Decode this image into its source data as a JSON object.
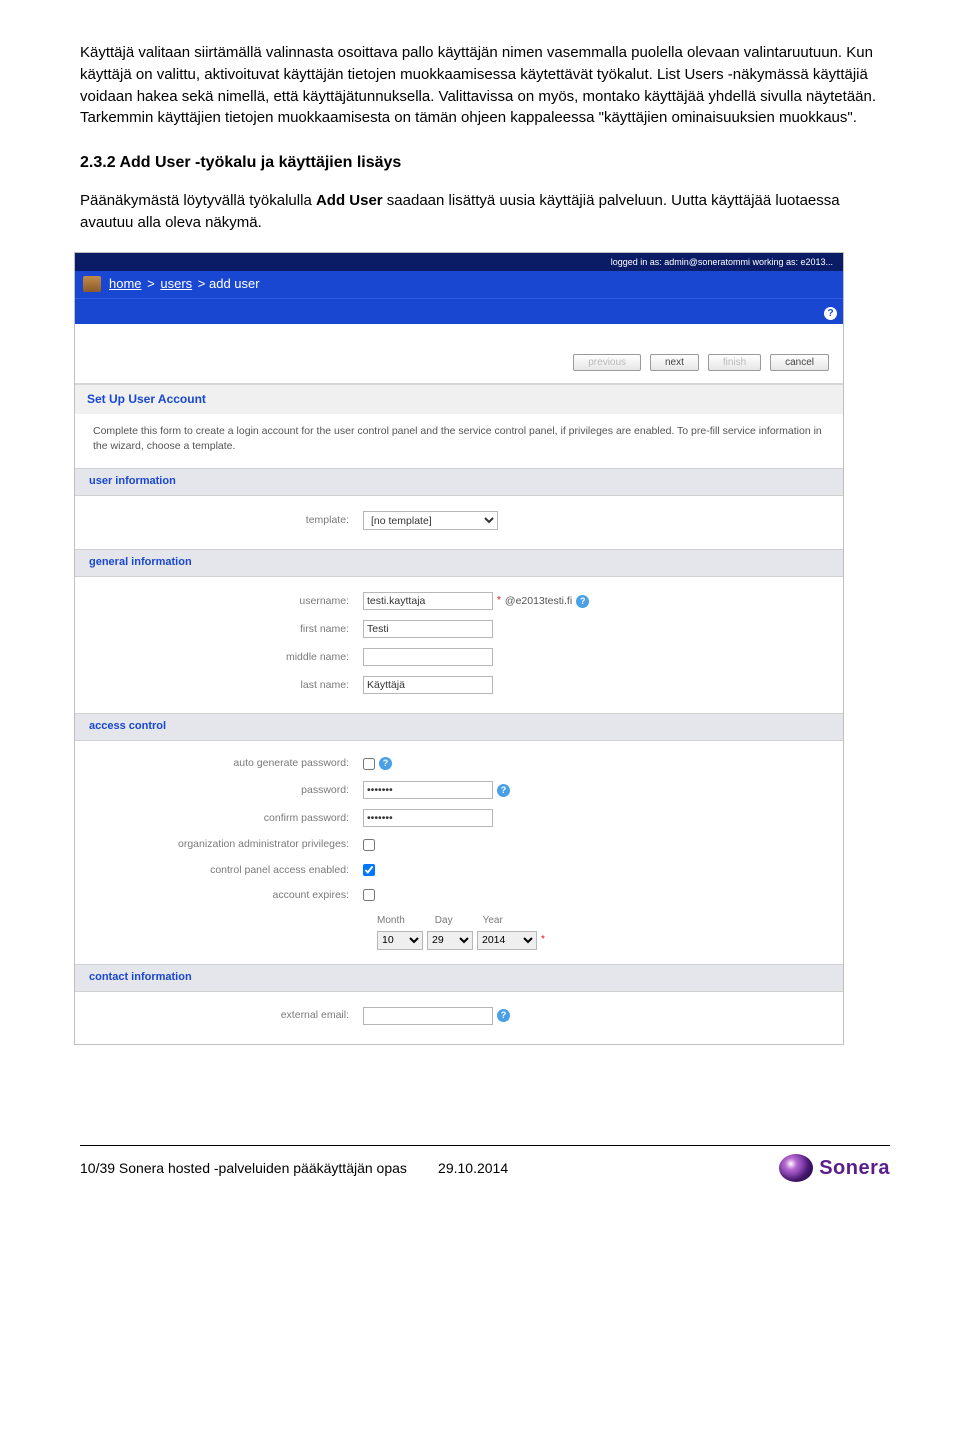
{
  "doc": {
    "p1": "Käyttäjä valitaan siirtämällä valinnasta osoittava pallo käyttäjän nimen vasemmalla puolella olevaan valintaruutuun. Kun käyttäjä on valittu, aktivoituvat käyttäjän tietojen muokkaamisessa käytettävät työkalut. List Users -näkymässä käyttäjiä voidaan hakea sekä nimellä, että käyttäjätunnuksella. Valittavissa on myös, montako käyttäjää yhdellä sivulla näytetään. Tarkemmin käyttäjien tietojen muokkaamisesta on tämän ohjeen kappaleessa \"käyttäjien ominaisuuksien muokkaus\".",
    "h3": "2.3.2 Add User -työkalu ja käyttäjien lisäys",
    "p2a": "Päänäkymästä löytyvällä työkalulla ",
    "p2b": "Add User",
    "p2c": " saadaan lisättyä uusia käyttäjiä palveluun. Uutta käyttäjää luotaessa avautuu alla oleva näkymä."
  },
  "topbar": "logged in as: admin@soneratommi   working as: e2013...",
  "crumbs": {
    "home": "home",
    "users": "users",
    "adduser": "add user"
  },
  "wizard": {
    "previous": "previous",
    "next": "next",
    "finish": "finish",
    "cancel": "cancel"
  },
  "setup": {
    "title": "Set Up User Account",
    "desc": "Complete this form to create a login account for the user control panel and the service control panel, if privileges are enabled. To pre-fill service information in the wizard, choose a template."
  },
  "sections": {
    "userinfo": "user information",
    "general": "general information",
    "access": "access control",
    "contact": "contact information"
  },
  "labels": {
    "template": "template:",
    "username": "username:",
    "firstname": "first name:",
    "middlename": "middle name:",
    "lastname": "last name:",
    "autogen": "auto generate password:",
    "password": "password:",
    "confirm": "confirm password:",
    "orgadmin": "organization administrator privileges:",
    "cpaccess": "control panel access enabled:",
    "expires": "account expires:",
    "month": "Month",
    "day": "Day",
    "year": "Year",
    "external": "external email:"
  },
  "values": {
    "template_option": "[no template]",
    "username": "testi.kayttaja",
    "domain": "@e2013testi.fi",
    "firstname": "Testi",
    "middlename": "",
    "lastname": "Käyttäjä",
    "password": "•••••••",
    "confirm": "•••••••",
    "month": "10",
    "day": "29",
    "year": "2014",
    "external": ""
  },
  "footer": {
    "left": "10/39   Sonera hosted -palveluiden pääkäyttäjän opas",
    "date": "29.10.2014",
    "brand": "Sonera"
  }
}
